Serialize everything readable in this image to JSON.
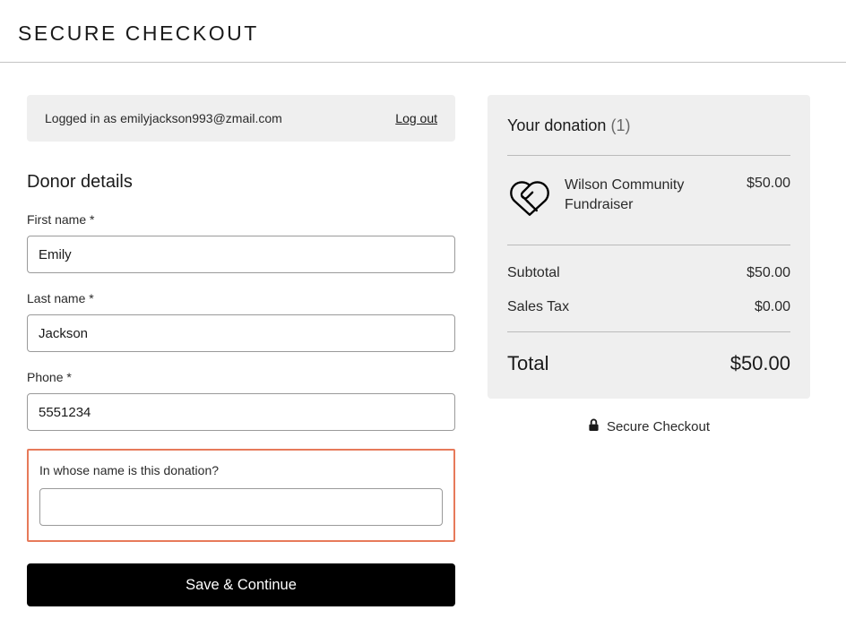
{
  "header": {
    "title": "SECURE CHECKOUT"
  },
  "login": {
    "prefix": "Logged in as ",
    "email": "emilyjackson993@zmail.com",
    "logout": "Log out"
  },
  "donor": {
    "title": "Donor details",
    "first_name_label": "First name *",
    "first_name_value": "Emily",
    "last_name_label": "Last name *",
    "last_name_value": "Jackson",
    "phone_label": "Phone *",
    "phone_value": "5551234",
    "dedication_label": "In whose name is this donation?",
    "dedication_value": ""
  },
  "submit": {
    "label": "Save & Continue"
  },
  "summary": {
    "title": "Your donation",
    "count": "(1)",
    "item_name": "Wilson Community Fundraiser",
    "item_price": "$50.00",
    "subtotal_label": "Subtotal",
    "subtotal_value": "$50.00",
    "tax_label": "Sales Tax",
    "tax_value": "$0.00",
    "total_label": "Total",
    "total_value": "$50.00",
    "secure_label": "Secure Checkout"
  }
}
